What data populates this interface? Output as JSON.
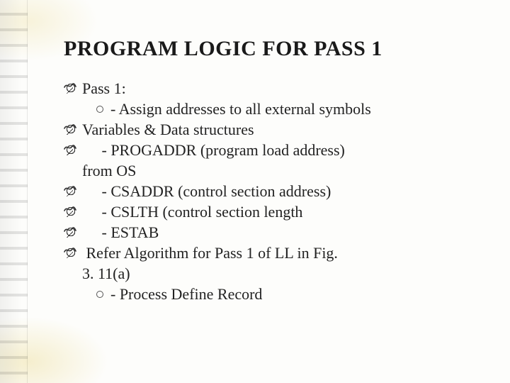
{
  "title": "PROGRAM LOGIC FOR PASS 1",
  "lines": {
    "l1": "Pass 1:",
    "l2": "- Assign addresses to all external symbols",
    "l3": "Variables & Data structures",
    "l4": "     - PROGADDR (program load address)",
    "l4b": "from OS",
    "l5": "     - CSADDR (control section address)",
    "l6": "     - CSLTH (control section length",
    "l7": "     - ESTAB",
    "l8": " Refer Algorithm for Pass 1 of LL in Fig.",
    "l8b": "3. 11(a)",
    "l9": "- Process Define Record"
  }
}
